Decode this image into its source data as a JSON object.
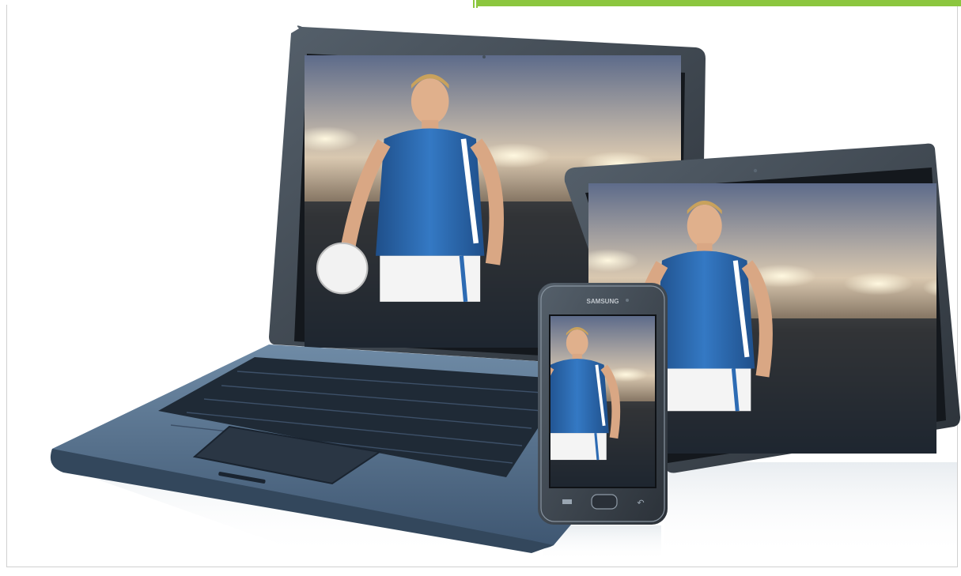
{
  "colors": {
    "accent_bar": "#8cc63f",
    "device_body": "#3c4650",
    "device_bezel": "#1e2329",
    "laptop_deck": "#5b7893",
    "jersey": "#2d6bb3",
    "stadium_sky": "#d9c8b0"
  },
  "scene": {
    "devices": [
      "laptop",
      "tablet",
      "smartphone"
    ],
    "phone_brand_text": "SAMSUNG"
  }
}
